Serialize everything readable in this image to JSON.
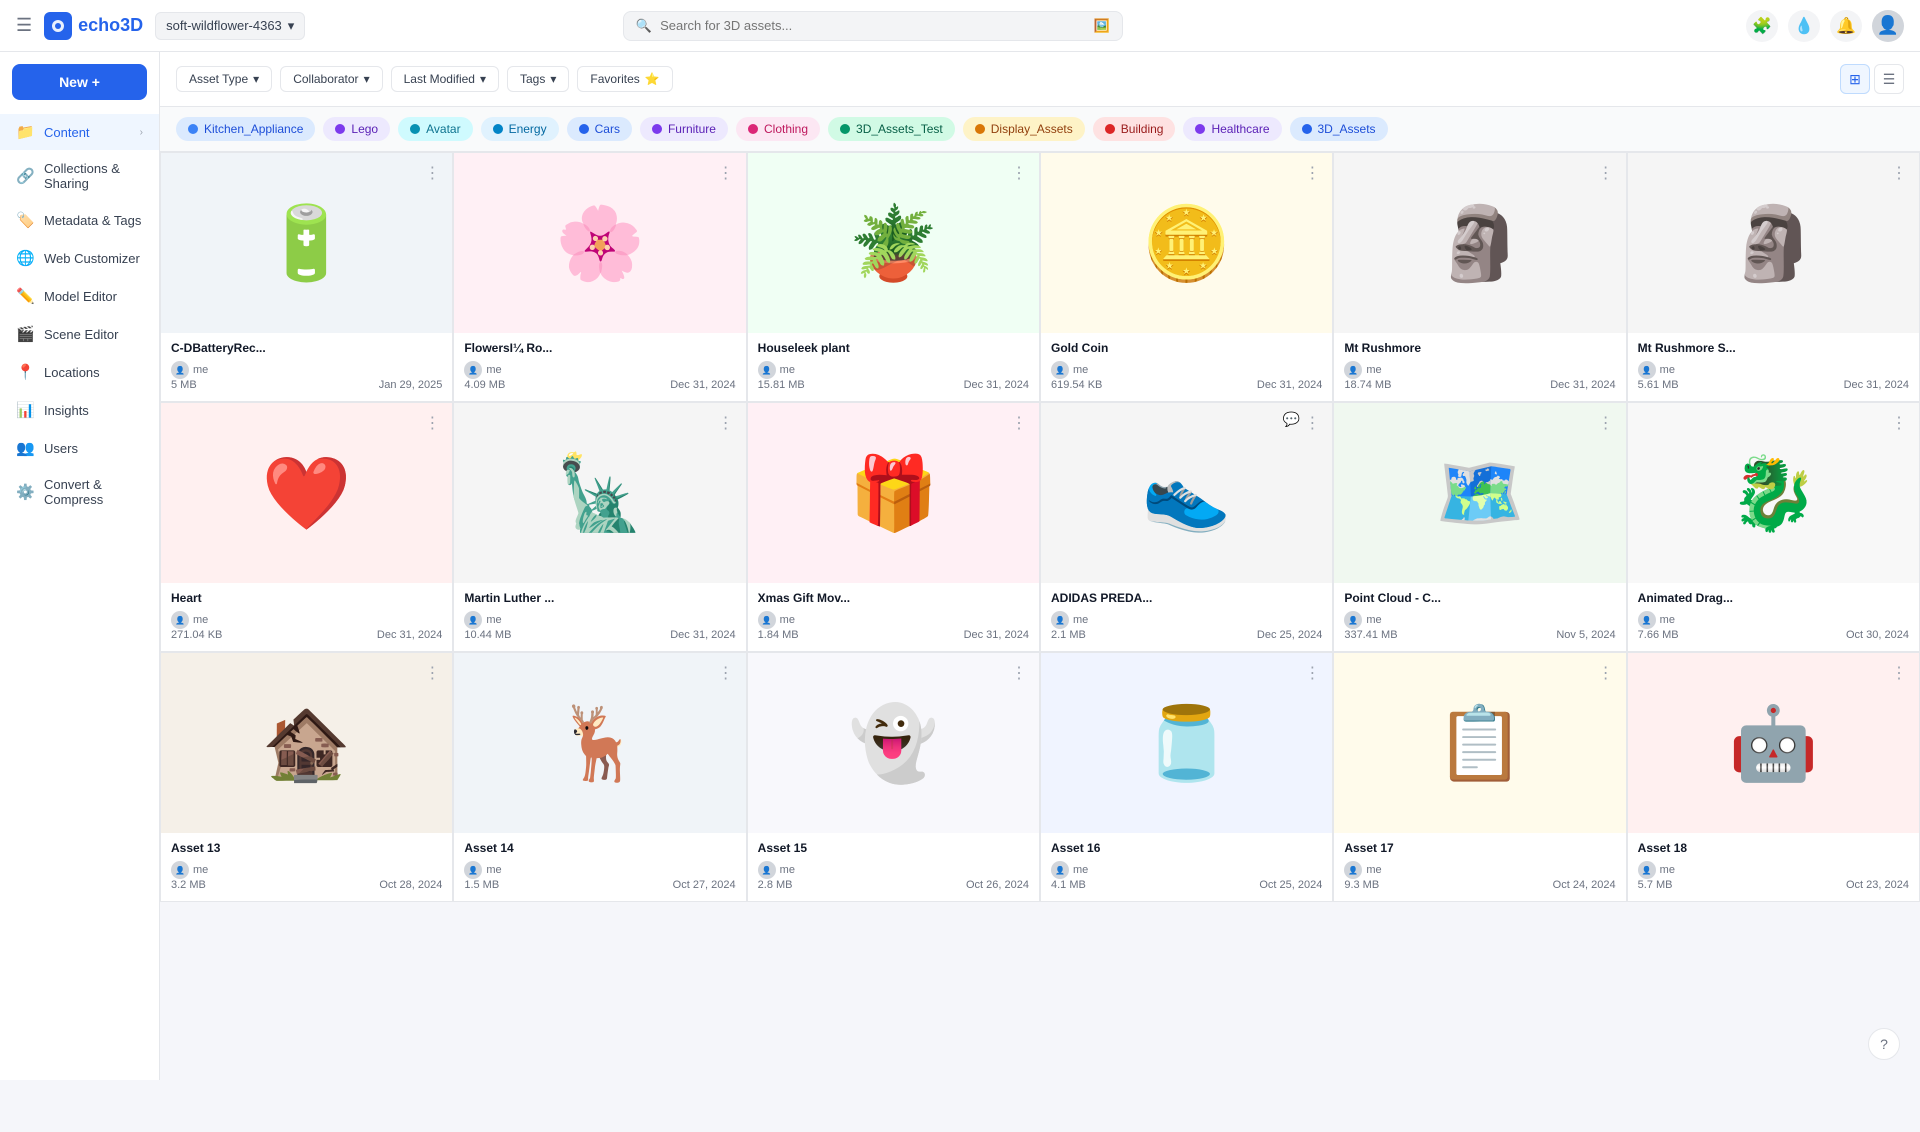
{
  "app": {
    "name": "echo3D",
    "logo_text": "echo3D"
  },
  "workspace": {
    "name": "soft-wildflower-4363"
  },
  "search": {
    "placeholder": "Search for 3D assets..."
  },
  "nav_actions": [
    {
      "name": "puzzle-icon",
      "label": "Extensions",
      "icon": "🧩"
    },
    {
      "name": "drop-icon",
      "label": "Drop",
      "icon": "💧"
    },
    {
      "name": "bell-icon",
      "label": "Notifications",
      "icon": "🔔"
    },
    {
      "name": "user-avatar",
      "label": "User",
      "icon": "👤"
    }
  ],
  "sidebar": {
    "new_button": "New +",
    "items": [
      {
        "id": "content",
        "label": "Content",
        "icon": "📁",
        "active": true,
        "has_chevron": true
      },
      {
        "id": "collections",
        "label": "Collections & Sharing",
        "icon": "🔗",
        "active": false
      },
      {
        "id": "metadata",
        "label": "Metadata & Tags",
        "icon": "🏷️",
        "active": false
      },
      {
        "id": "web-customizer",
        "label": "Web Customizer",
        "icon": "🌐",
        "active": false
      },
      {
        "id": "model-editor",
        "label": "Model Editor",
        "icon": "✏️",
        "active": false
      },
      {
        "id": "scene-editor",
        "label": "Scene Editor",
        "icon": "🎬",
        "active": false
      },
      {
        "id": "locations",
        "label": "Locations",
        "icon": "📍",
        "active": false
      },
      {
        "id": "insights",
        "label": "Insights",
        "icon": "📊",
        "active": false
      },
      {
        "id": "users",
        "label": "Users",
        "icon": "👥",
        "active": false
      },
      {
        "id": "convert",
        "label": "Convert & Compress",
        "icon": "⚙️",
        "active": false
      }
    ]
  },
  "filters": [
    {
      "id": "asset-type",
      "label": "Asset Type",
      "icon": "▾"
    },
    {
      "id": "collaborator",
      "label": "Collaborator",
      "icon": "▾"
    },
    {
      "id": "last-modified",
      "label": "Last Modified",
      "icon": "▾"
    },
    {
      "id": "tags",
      "label": "Tags",
      "icon": "▾"
    },
    {
      "id": "favorites",
      "label": "Favorites",
      "icon": "⭐"
    }
  ],
  "categories": [
    {
      "id": "kitchen",
      "label": "Kitchen_Appliance",
      "color": "#3b82f6",
      "bg": "#dbeafe"
    },
    {
      "id": "lego",
      "label": "Lego",
      "color": "#6d28d9",
      "bg": "#ede9fe"
    },
    {
      "id": "avatar",
      "label": "Avatar",
      "color": "#0891b2",
      "bg": "#cffafe"
    },
    {
      "id": "energy",
      "label": "Energy",
      "color": "#0284c7",
      "bg": "#e0f2fe"
    },
    {
      "id": "cars",
      "label": "Cars",
      "color": "#2563eb",
      "bg": "#dbeafe"
    },
    {
      "id": "furniture",
      "label": "Furniture",
      "color": "#7c3aed",
      "bg": "#ede9fe"
    },
    {
      "id": "clothing",
      "label": "Clothing",
      "color": "#db2777",
      "bg": "#fce7f3"
    },
    {
      "id": "3dassets-test",
      "label": "3D_Assets_Test",
      "color": "#059669",
      "bg": "#d1fae5"
    },
    {
      "id": "display-assets",
      "label": "Display_Assets",
      "color": "#d97706",
      "bg": "#fef3c7"
    },
    {
      "id": "building",
      "label": "Building",
      "color": "#dc2626",
      "bg": "#fee2e2"
    },
    {
      "id": "healthcare",
      "label": "Healthcare",
      "color": "#7c3aed",
      "bg": "#ede9fe"
    },
    {
      "id": "3dassets",
      "label": "3D_Assets",
      "color": "#2563eb",
      "bg": "#dbeafe"
    }
  ],
  "assets": [
    {
      "id": 1,
      "name": "C-DBatteryRec...",
      "size": "5 MB",
      "date": "Jan 29, 2025",
      "user": "me",
      "emoji": "🔋",
      "bg": "#f0f4f8"
    },
    {
      "id": 2,
      "name": "FlowersI¼   Ro...",
      "size": "4.09 MB",
      "date": "Dec 31, 2024",
      "user": "me",
      "emoji": "🌸",
      "bg": "#fff0f5"
    },
    {
      "id": 3,
      "name": "Houseleek plant",
      "size": "15.81 MB",
      "date": "Dec 31, 2024",
      "user": "me",
      "emoji": "🪴",
      "bg": "#f0fff4"
    },
    {
      "id": 4,
      "name": "Gold Coin",
      "size": "619.54 KB",
      "date": "Dec 31, 2024",
      "user": "me",
      "emoji": "🪙",
      "bg": "#fffbeb"
    },
    {
      "id": 5,
      "name": "Mt Rushmore",
      "size": "18.74 MB",
      "date": "Dec 31, 2024",
      "user": "me",
      "emoji": "🗿",
      "bg": "#f5f5f5"
    },
    {
      "id": 6,
      "name": "Mt Rushmore S...",
      "size": "5.61 MB",
      "date": "Dec 31, 2024",
      "user": "me",
      "emoji": "🗿",
      "bg": "#f5f5f5"
    },
    {
      "id": 7,
      "name": "Heart",
      "size": "271.04 KB",
      "date": "Dec 31, 2024",
      "user": "me",
      "emoji": "❤️",
      "bg": "#fff0f0"
    },
    {
      "id": 8,
      "name": "Martin Luther ...",
      "size": "10.44 MB",
      "date": "Dec 31, 2024",
      "user": "me",
      "emoji": "🗽",
      "bg": "#f5f5f5"
    },
    {
      "id": 9,
      "name": "Xmas Gift Mov...",
      "size": "1.84 MB",
      "date": "Dec 31, 2024",
      "user": "me",
      "emoji": "🎁",
      "bg": "#fff0f5"
    },
    {
      "id": 10,
      "name": "ADIDAS PREDA...",
      "size": "2.1 MB",
      "date": "Dec 25, 2024",
      "user": "me",
      "emoji": "👟",
      "bg": "#f5f5f5",
      "has_comment": true
    },
    {
      "id": 11,
      "name": "Point Cloud - C...",
      "size": "337.41 MB",
      "date": "Nov 5, 2024",
      "user": "me",
      "emoji": "🗺️",
      "bg": "#f0f8f0"
    },
    {
      "id": 12,
      "name": "Animated Drag...",
      "size": "7.66 MB",
      "date": "Oct 30, 2024",
      "user": "me",
      "emoji": "🐉",
      "bg": "#f8f8f8"
    },
    {
      "id": 13,
      "name": "Asset 13",
      "size": "3.2 MB",
      "date": "Oct 28, 2024",
      "user": "me",
      "emoji": "🏚️",
      "bg": "#f5f0e8"
    },
    {
      "id": 14,
      "name": "Asset 14",
      "size": "1.5 MB",
      "date": "Oct 27, 2024",
      "user": "me",
      "emoji": "🦌",
      "bg": "#f0f4f8"
    },
    {
      "id": 15,
      "name": "Asset 15",
      "size": "2.8 MB",
      "date": "Oct 26, 2024",
      "user": "me",
      "emoji": "👻",
      "bg": "#f8f8fc"
    },
    {
      "id": 16,
      "name": "Asset 16",
      "size": "4.1 MB",
      "date": "Oct 25, 2024",
      "user": "me",
      "emoji": "🫙",
      "bg": "#f0f4ff"
    },
    {
      "id": 17,
      "name": "Asset 17",
      "size": "9.3 MB",
      "date": "Oct 24, 2024",
      "user": "me",
      "emoji": "📋",
      "bg": "#fffbeb"
    },
    {
      "id": 18,
      "name": "Asset 18",
      "size": "5.7 MB",
      "date": "Oct 23, 2024",
      "user": "me",
      "emoji": "🤖",
      "bg": "#fff0f0"
    }
  ],
  "view": {
    "grid_icon": "⊞",
    "list_icon": "☰"
  }
}
